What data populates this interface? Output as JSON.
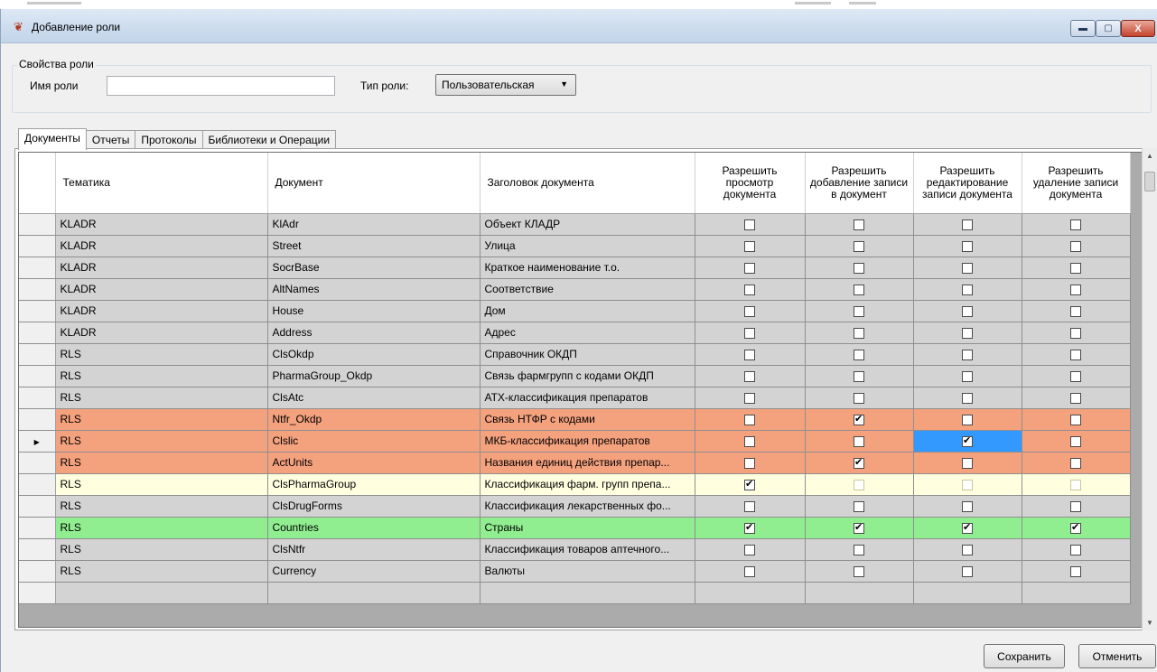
{
  "window": {
    "title": "Добавление роли",
    "controls": {
      "minimize": "▬",
      "maximize": "▢",
      "close": "X"
    }
  },
  "role_properties": {
    "group_label": "Свойства роли",
    "name_label": "Имя роли",
    "name_value": "",
    "type_label": "Тип роли:",
    "type_value": "Пользовательская"
  },
  "tabs": [
    {
      "label": "Документы",
      "active": true
    },
    {
      "label": "Отчеты",
      "active": false
    },
    {
      "label": "Протоколы",
      "active": false
    },
    {
      "label": "Библиотеки и Операции",
      "active": false
    }
  ],
  "grid": {
    "columns": [
      "Тематика",
      "Документ",
      "Заголовок документа",
      "Разрешить просмотр документа",
      "Разрешить добавление записи в документ",
      "Разрешить редактирование записи документа",
      "Разрешить удаление записи документа"
    ],
    "row_colors": {
      "gray": "#d3d3d3",
      "salmon": "#f4a17e",
      "yellow": "#ffffe0",
      "green": "#90ee90",
      "selected_cell": "#3399ff"
    },
    "rows": [
      {
        "theme": "KLADR",
        "doc": "KlAdr",
        "title": "Объект КЛАДР",
        "color": "gray",
        "perms": [
          false,
          false,
          false,
          false
        ]
      },
      {
        "theme": "KLADR",
        "doc": "Street",
        "title": "Улица",
        "color": "gray",
        "perms": [
          false,
          false,
          false,
          false
        ]
      },
      {
        "theme": "KLADR",
        "doc": "SocrBase",
        "title": "Краткое наименование т.о.",
        "color": "gray",
        "perms": [
          false,
          false,
          false,
          false
        ]
      },
      {
        "theme": "KLADR",
        "doc": "AltNames",
        "title": "Соответствие",
        "color": "gray",
        "perms": [
          false,
          false,
          false,
          false
        ]
      },
      {
        "theme": "KLADR",
        "doc": "House",
        "title": "Дом",
        "color": "gray",
        "perms": [
          false,
          false,
          false,
          false
        ]
      },
      {
        "theme": "KLADR",
        "doc": "Address",
        "title": "Адрес",
        "color": "gray",
        "perms": [
          false,
          false,
          false,
          false
        ]
      },
      {
        "theme": "RLS",
        "doc": "ClsOkdp",
        "title": "Справочник ОКДП",
        "color": "gray",
        "perms": [
          false,
          false,
          false,
          false
        ]
      },
      {
        "theme": "RLS",
        "doc": "PharmaGroup_Okdp",
        "title": "Связь фармгрупп с кодами ОКДП",
        "color": "gray",
        "perms": [
          false,
          false,
          false,
          false
        ]
      },
      {
        "theme": "RLS",
        "doc": "ClsAtc",
        "title": "АТХ-классификация препаратов",
        "color": "gray",
        "perms": [
          false,
          false,
          false,
          false
        ]
      },
      {
        "theme": "RLS",
        "doc": "Ntfr_Okdp",
        "title": "Связь НТФР с кодами",
        "color": "salmon",
        "perms": [
          false,
          true,
          false,
          false
        ]
      },
      {
        "theme": "RLS",
        "doc": "Clslic",
        "title": "МКБ-классификация препаратов",
        "color": "salmon",
        "perms": [
          false,
          false,
          true,
          false
        ],
        "current": true,
        "selected_col": 2
      },
      {
        "theme": "RLS",
        "doc": "ActUnits",
        "title": "Названия единиц действия препар...",
        "color": "salmon",
        "perms": [
          false,
          true,
          false,
          false
        ]
      },
      {
        "theme": "RLS",
        "doc": "ClsPharmaGroup",
        "title": "Классификация фарм. групп препа...",
        "color": "yellow",
        "perms": [
          true,
          false,
          false,
          false
        ]
      },
      {
        "theme": "RLS",
        "doc": "ClsDrugForms",
        "title": "Классификация лекарственных фо...",
        "color": "gray",
        "perms": [
          false,
          false,
          false,
          false
        ]
      },
      {
        "theme": "RLS",
        "doc": "Countries",
        "title": "Страны",
        "color": "green",
        "perms": [
          true,
          true,
          true,
          true
        ]
      },
      {
        "theme": "RLS",
        "doc": "ClsNtfr",
        "title": "Классификация товаров аптечного...",
        "color": "gray",
        "perms": [
          false,
          false,
          false,
          false
        ]
      },
      {
        "theme": "RLS",
        "doc": "Currency",
        "title": "Валюты",
        "color": "gray",
        "perms": [
          false,
          false,
          false,
          false
        ]
      }
    ]
  },
  "buttons": {
    "save": "Сохранить",
    "cancel": "Отменить"
  }
}
